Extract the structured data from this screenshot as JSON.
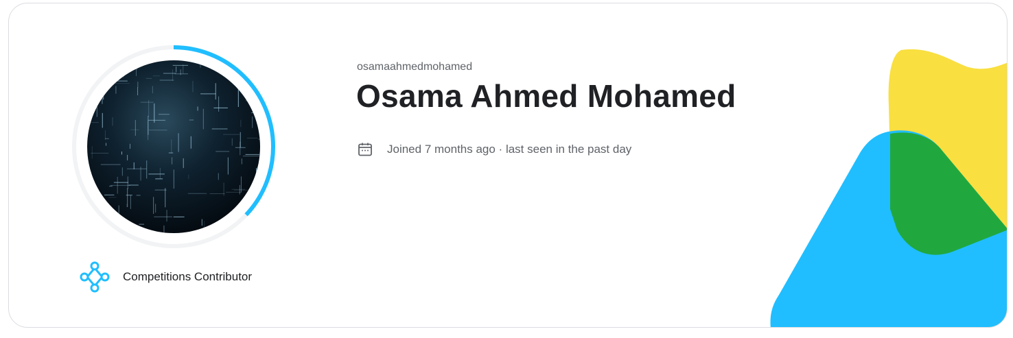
{
  "profile": {
    "username": "osamaahmedmohamed",
    "display_name": "Osama Ahmed Mohamed",
    "joined_text": "Joined 7 months ago · last seen in the past day",
    "tier_label": "Competitions Contributor",
    "tier_icon": "contributor-network-icon",
    "calendar_icon": "calendar-icon",
    "progress": 0.37
  },
  "colors": {
    "accent": "#20beff",
    "yellow": "#f9df40",
    "green": "#20a83e",
    "ring_track": "#f1f3f4",
    "text_primary": "#202124",
    "text_secondary": "#5f6368"
  }
}
